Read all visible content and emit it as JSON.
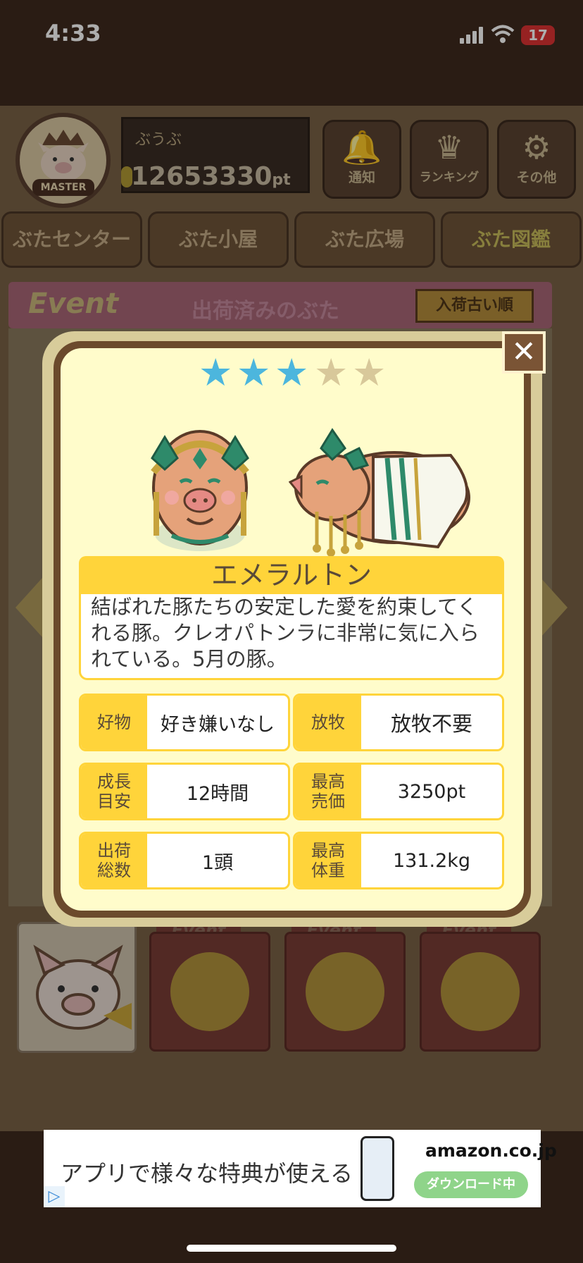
{
  "status_bar": {
    "time": "4:33",
    "battery": "17"
  },
  "header": {
    "badge_label": "MASTER",
    "user_name": "ぶうぶ",
    "points": "12653330",
    "points_unit": "pt",
    "buttons": [
      {
        "label": "通知",
        "icon": "bell-icon"
      },
      {
        "label": "ランキング",
        "icon": "crown-icon"
      },
      {
        "label": "その他",
        "icon": "gear-icon"
      }
    ]
  },
  "nav": {
    "tabs": [
      "ぶたセンター",
      "ぶた小屋",
      "ぶた広場",
      "ぶた図鑑"
    ],
    "active": "ぶた図鑑"
  },
  "list_header": {
    "event_logo": "Event",
    "title": "出荷済みのぶた",
    "sort_button": "入荷古い順"
  },
  "bottom": {
    "tab_labels": [
      "Event",
      "Event",
      "Event"
    ]
  },
  "modal": {
    "rating": {
      "filled": 3,
      "total": 5
    },
    "pig_name": "エメラルトン",
    "description": "結ばれた豚たちの安定した愛を約束してくれる豚。クレオパトンラに非常に気に入られている。5月の豚。",
    "stats": [
      {
        "key": "好物",
        "value": "好き嫌いなし"
      },
      {
        "key": "放牧",
        "value": "放牧不要"
      },
      {
        "key": "成長目安",
        "value": "12時間"
      },
      {
        "key": "最高売価",
        "value": "3250pt"
      },
      {
        "key": "出荷総数",
        "value": "1頭"
      },
      {
        "key": "最高体重",
        "value": "131.2kg"
      }
    ]
  },
  "ad": {
    "text": "アプリで様々な特典が使える",
    "brand": "amazon.co.jp",
    "button": "ダウンロード中"
  },
  "colors": {
    "modal_bg": "#fffccb",
    "accent_yellow": "#ffd43a",
    "star_on": "#4cb6dd",
    "star_off": "#d8c89a",
    "frame_brown": "#6b4a2c"
  }
}
